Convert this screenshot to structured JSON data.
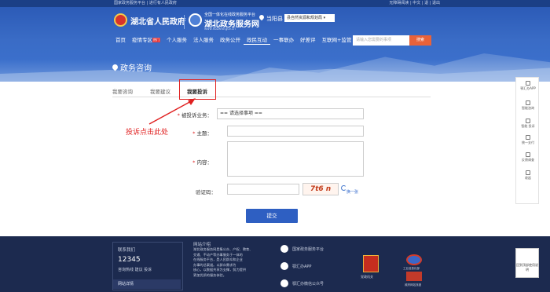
{
  "topbar": {
    "left": "国家政务服务平台 | 进行有人民政府",
    "right": "无障碍阅读 | 中文 | 退 | 退出"
  },
  "header": {
    "gov_name": "湖北省人民政府",
    "svc_small": "全国一体化在线政务服务平台",
    "svc_name": "湖北政务服务网",
    "svc_url": "www.hbzwfw.gov.cn",
    "city": "当阳县",
    "dept": "县自然资源和规划局 ▾"
  },
  "nav": {
    "items": [
      "首页",
      "疫情专区",
      "个人服务",
      "法人服务",
      "政务公开",
      "政民互动",
      "一事联办",
      "好差评",
      "互联网+监管"
    ],
    "hot": "热门",
    "active": "政民互动"
  },
  "search": {
    "placeholder": "请输入您需要的事项",
    "button": "搜索"
  },
  "page_title": "政务咨询",
  "tabs": [
    "我要咨询",
    "我要建议",
    "我要投诉"
  ],
  "hint": "投诉点击此处",
  "form": {
    "type_label": "被投诉业务：",
    "type_value": "== 请选择事项 ==",
    "subject_label": "主题：",
    "content_label": "内容：",
    "captcha_label": "验证码：",
    "captcha_text": "7t6 n",
    "swap": "换一张",
    "submit": "提交",
    "required": "*"
  },
  "sidebar": [
    "鄂汇办APP",
    "智能咨询",
    "智能 投诉",
    "统一支付",
    "反馈调查",
    "收起"
  ],
  "footer": {
    "contact_title": "联系我们",
    "phone": "12345",
    "contact_note": "咨询热线 建议 投诉",
    "intro_title": "网站介绍",
    "intro_lines": [
      "湖北政务服务网是集公众、产权、教育、",
      "交通、不动产等办事服务于一体的",
      "在线服务平台，是人民群众和企业",
      "办事的总渠道。以群众需求为",
      "核心，以数据共享为支撑，努力提供",
      "更加优质的服务体验。"
    ],
    "links": [
      "国家政务服务平台",
      "鄂汇办APP",
      "鄂汇办微信公众号"
    ],
    "more": "网站详情",
    "badge1": "党政机关",
    "badge2": "工业信息化部",
    "badge3": "政府网站找错",
    "side2": "回到顶部使用说明"
  },
  "colors": {
    "brand": "#2e5fc2",
    "header": "#3a6cc6",
    "accent": "#e02020",
    "footer": "#1c2a4f"
  }
}
